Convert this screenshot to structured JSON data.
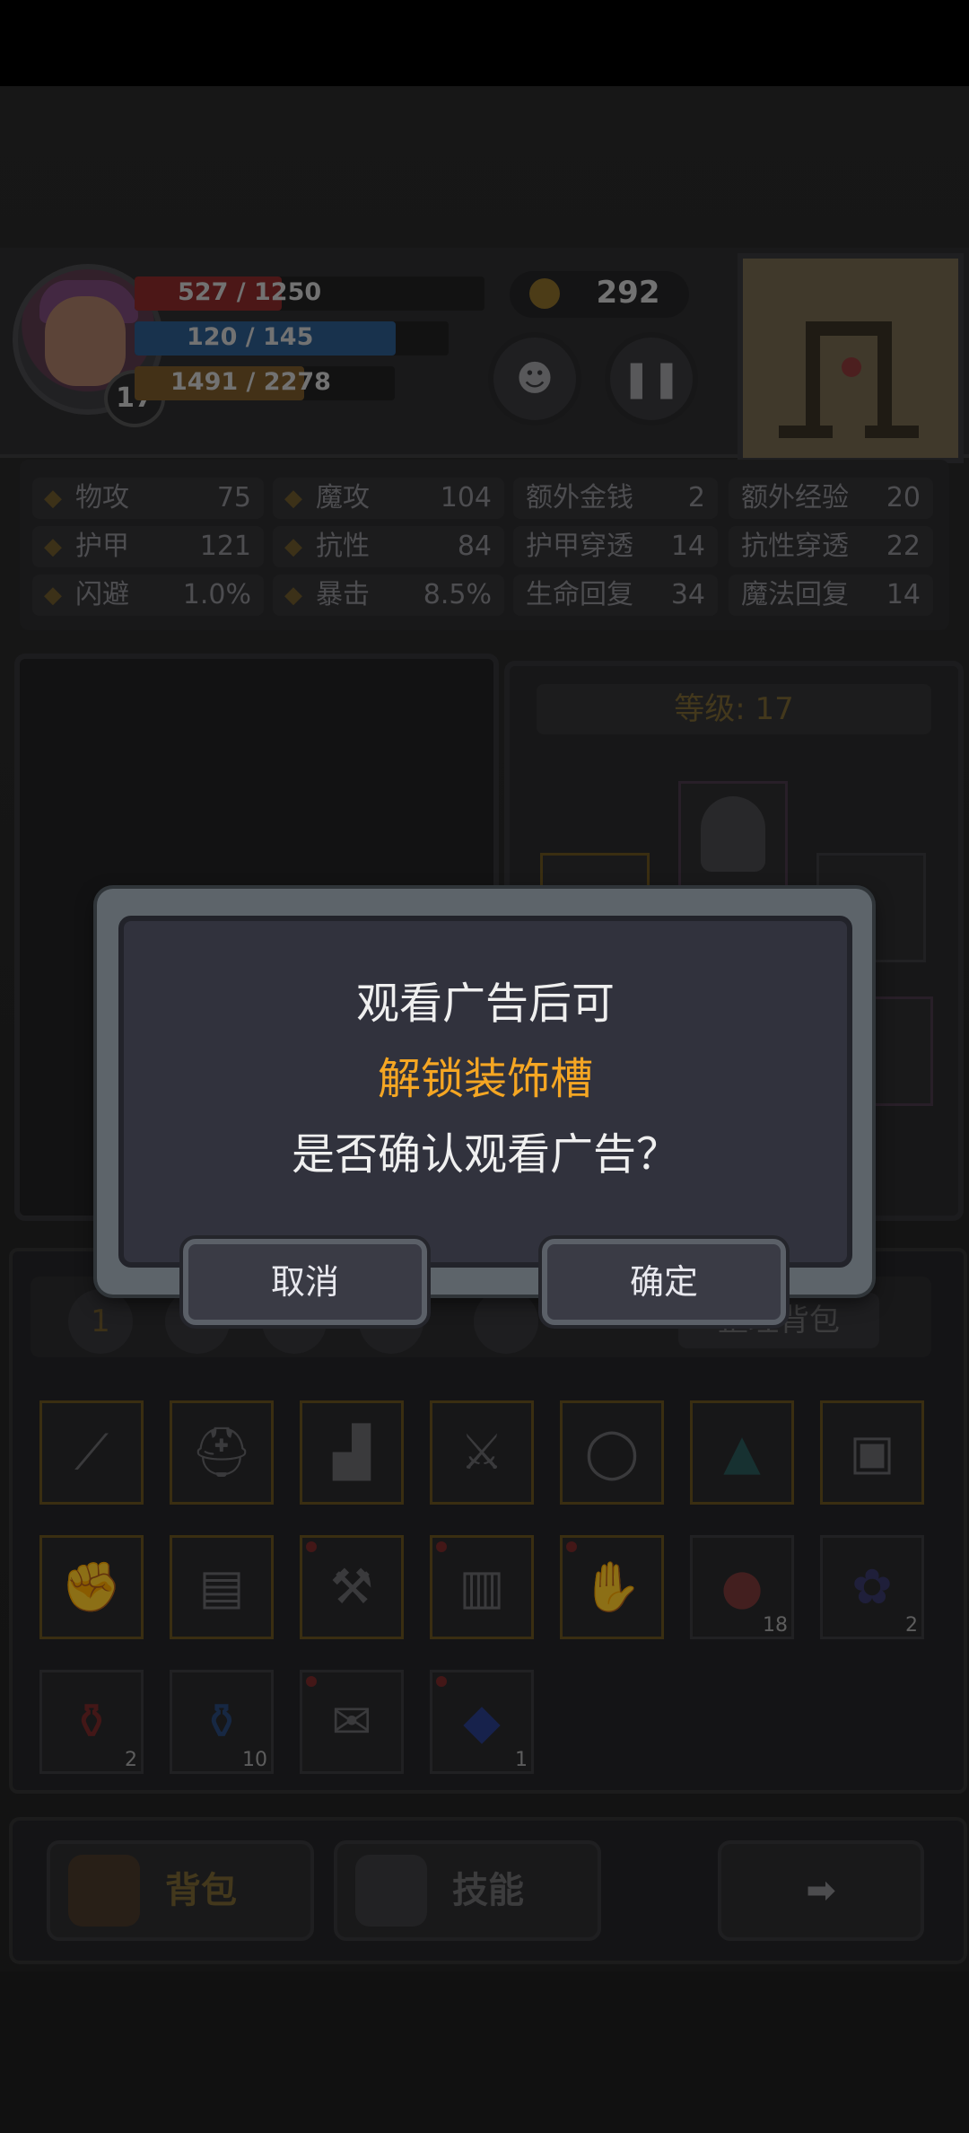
{
  "hud": {
    "hp": "527 / 1250",
    "hp_fraction": 0.42,
    "mp": "120 / 145",
    "mp_fraction": 0.83,
    "xp": "1491 / 2278",
    "xp_fraction": 0.65,
    "level": "17",
    "coins": "292",
    "pause_icon": "pause-icon",
    "pet_icon": "cat-face-icon"
  },
  "stats": [
    {
      "label": "物攻",
      "value": "75",
      "icon": "sword-icon"
    },
    {
      "label": "魔攻",
      "value": "104",
      "icon": "magic-hand-icon"
    },
    {
      "label": "额外金钱",
      "value": "2"
    },
    {
      "label": "额外经验",
      "value": "20"
    },
    {
      "label": "护甲",
      "value": "121",
      "icon": "paw-shield-icon"
    },
    {
      "label": "抗性",
      "value": "84",
      "icon": "horns-icon"
    },
    {
      "label": "护甲穿透",
      "value": "14"
    },
    {
      "label": "抗性穿透",
      "value": "22"
    },
    {
      "label": "闪避",
      "value": "1.0%",
      "icon": "running-icon"
    },
    {
      "label": "暴击",
      "value": "8.5%",
      "icon": "lightning-icon"
    },
    {
      "label": "生命回复",
      "value": "34"
    },
    {
      "label": "魔法回复",
      "value": "14"
    }
  ],
  "equipment": {
    "level_label": "等级: 17"
  },
  "bag": {
    "tab1": "1",
    "sort_label": "整理背包",
    "items": [
      {
        "icon": "staff-icon"
      },
      {
        "icon": "horned-helmet-icon"
      },
      {
        "icon": "boots-icon"
      },
      {
        "icon": "sword-icon"
      },
      {
        "icon": "ring-icon"
      },
      {
        "icon": "wizard-hat-icon"
      },
      {
        "icon": "chest-armor-icon"
      },
      {
        "icon": "gauntlet-icon"
      },
      {
        "icon": "plate-armor-icon"
      },
      {
        "icon": "axe-icon"
      },
      {
        "icon": "robe-icon"
      },
      {
        "icon": "metal-gauntlet-icon"
      },
      {
        "icon": "meat-icon",
        "count": "18"
      },
      {
        "icon": "berries-icon",
        "count": "2"
      },
      {
        "icon": "red-potion-icon",
        "count": "2"
      },
      {
        "icon": "blue-potion-icon",
        "count": "10"
      },
      {
        "icon": "scroll-icon"
      },
      {
        "icon": "blue-gem-icon",
        "count": "1"
      }
    ]
  },
  "nav": {
    "bag_label": "背包",
    "skills_label": "技能",
    "next_icon": "arrow-right-icon"
  },
  "dialog": {
    "line1": "观看广告后可",
    "line2": "解锁装饰槽",
    "line3": "是否确认观看广告？",
    "cancel": "取消",
    "confirm": "确定",
    "highlight_color": "#f5a623"
  }
}
